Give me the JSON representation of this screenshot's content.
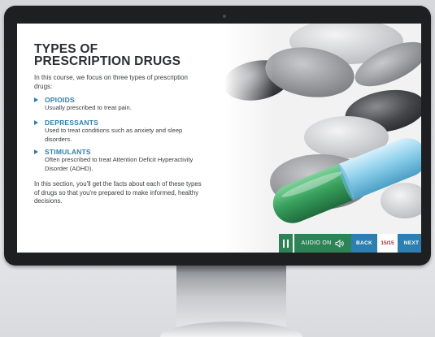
{
  "slide": {
    "title_lines": [
      "TYPES OF",
      "PRESCRIPTION DRUGS"
    ],
    "intro": "In this course, we focus on three types of prescription drugs:",
    "drugs": [
      {
        "name": "OPIOIDS",
        "description": "Usually prescribed to treat pain."
      },
      {
        "name": "DEPRESSANTS",
        "description": "Used to treat conditions such as anxiety and sleep disorders."
      },
      {
        "name": "STIMULANTS",
        "description": "Often prescribed to treat Attention Deficit Hyperactivity Disorder (ADHD)."
      }
    ],
    "outro": "In this section, you'll get the facts about each of these types of drugs so that you're prepared to make informed, healthy decisions."
  },
  "nav": {
    "audio_label": "AUDIO ON",
    "back_label": "BACK",
    "page": "15/15",
    "next_label": "NEXT"
  },
  "icons": {
    "pause": "pause-icon",
    "speaker": "speaker-icon",
    "bullet": "triangle-bullet-icon"
  },
  "colors": {
    "accent_blue": "#2e7fa8",
    "nav_green": "#2d8356",
    "nav_blue": "#2c7fb0",
    "page_red": "#a52e36",
    "capsule_green": "#3aa25f",
    "capsule_blue": "#8fd0ec"
  }
}
